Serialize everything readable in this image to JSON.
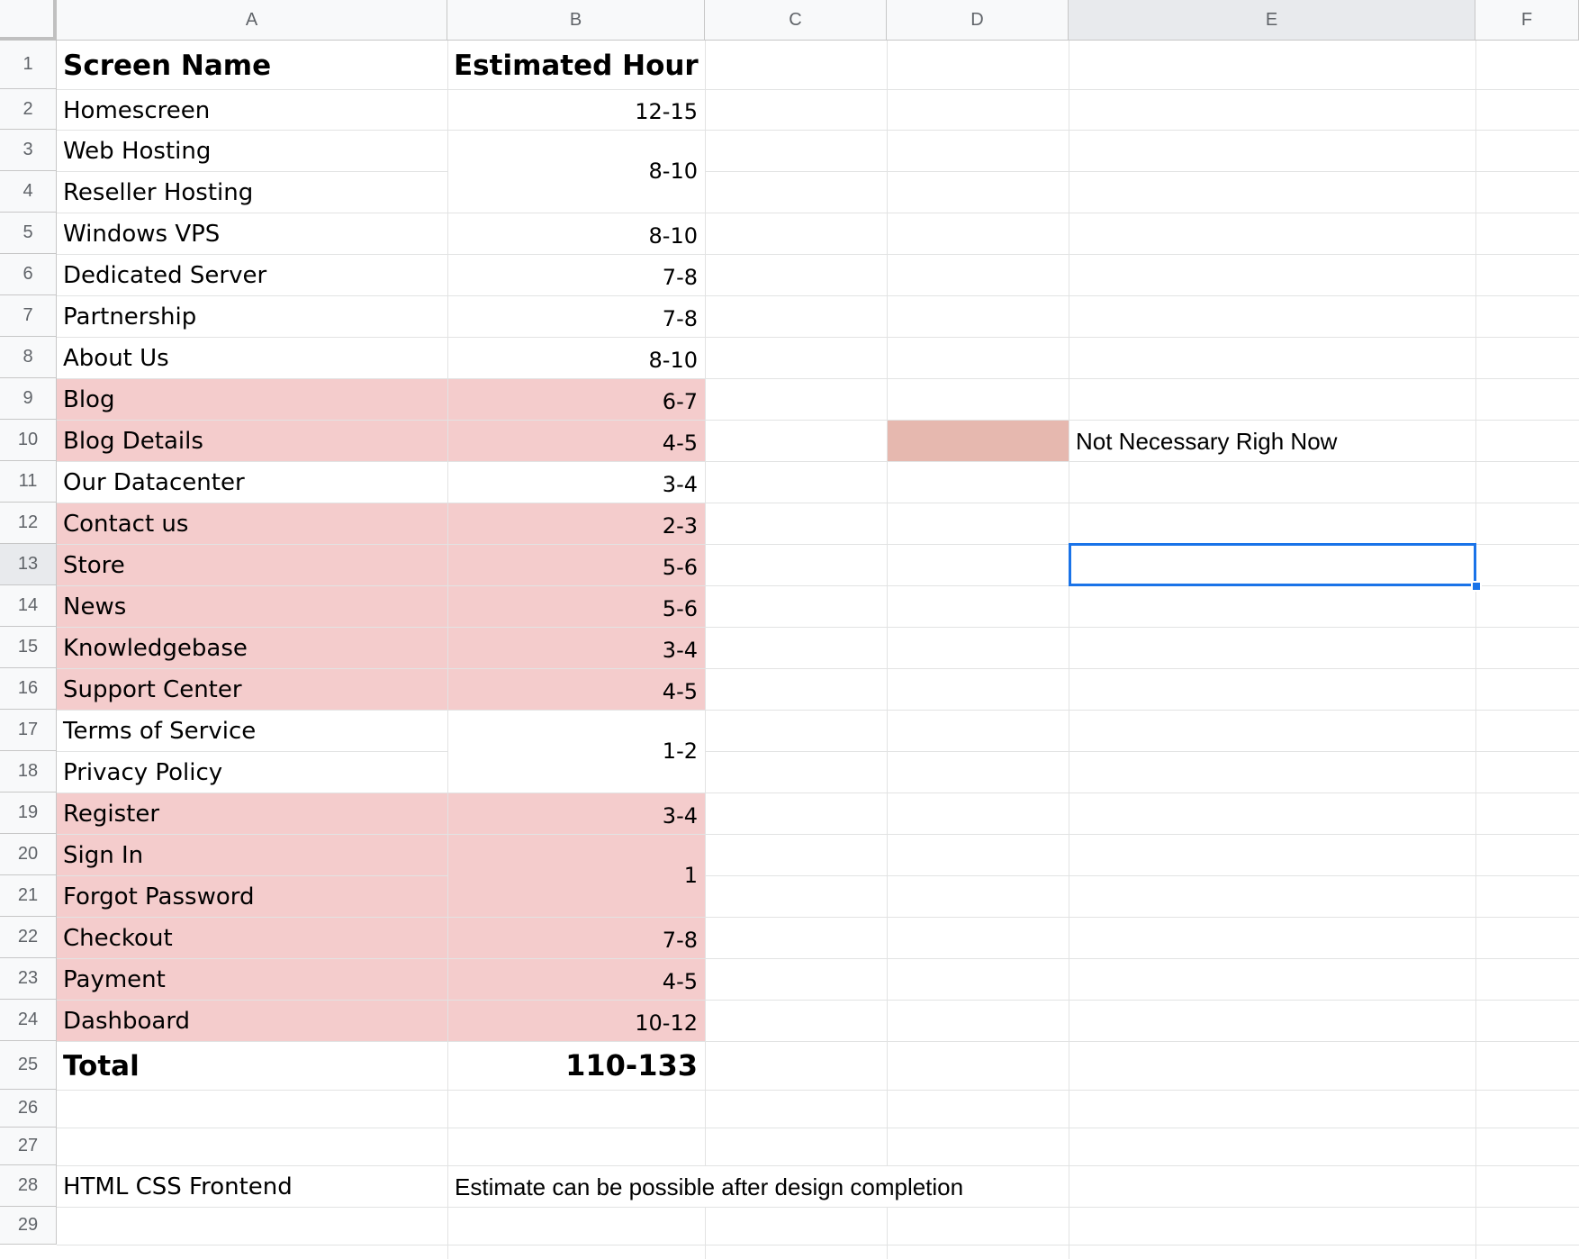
{
  "columns": [
    "A",
    "B",
    "C",
    "D",
    "E",
    "F"
  ],
  "row_numbers": [
    "1",
    "2",
    "3",
    "4",
    "5",
    "6",
    "7",
    "8",
    "9",
    "10",
    "11",
    "12",
    "13",
    "14",
    "15",
    "16",
    "17",
    "18",
    "19",
    "20",
    "21",
    "22",
    "23",
    "24",
    "25",
    "26",
    "27",
    "28",
    "29"
  ],
  "header": {
    "screen_name": "Screen Name",
    "estimated_hour": "Estimated Hour"
  },
  "screens": [
    {
      "name": "Homescreen",
      "not_necessary": false
    },
    {
      "name": "Web Hosting",
      "not_necessary": false
    },
    {
      "name": "Reseller Hosting",
      "not_necessary": false
    },
    {
      "name": "Windows VPS",
      "not_necessary": false
    },
    {
      "name": "Dedicated Server",
      "not_necessary": false
    },
    {
      "name": "Partnership",
      "not_necessary": false
    },
    {
      "name": "About Us",
      "not_necessary": false
    },
    {
      "name": "Blog",
      "not_necessary": true
    },
    {
      "name": "Blog Details",
      "not_necessary": true
    },
    {
      "name": "Our Datacenter",
      "not_necessary": false
    },
    {
      "name": "Contact us",
      "not_necessary": true
    },
    {
      "name": "Store",
      "not_necessary": true
    },
    {
      "name": "News",
      "not_necessary": true
    },
    {
      "name": "Knowledgebase",
      "not_necessary": true
    },
    {
      "name": "Support Center",
      "not_necessary": true
    },
    {
      "name": "Terms of Service",
      "not_necessary": false
    },
    {
      "name": "Privacy Policy",
      "not_necessary": false
    },
    {
      "name": "Register",
      "not_necessary": true
    },
    {
      "name": "Sign In",
      "not_necessary": true
    },
    {
      "name": "Forgot Password",
      "not_necessary": true
    },
    {
      "name": "Checkout",
      "not_necessary": true
    },
    {
      "name": "Payment",
      "not_necessary": true
    },
    {
      "name": "Dashboard",
      "not_necessary": true
    }
  ],
  "hours": [
    {
      "value": "12-15",
      "rows": [
        2
      ]
    },
    {
      "value": "8-10",
      "rows": [
        3,
        4
      ]
    },
    {
      "value": "8-10",
      "rows": [
        5
      ]
    },
    {
      "value": "7-8",
      "rows": [
        6
      ]
    },
    {
      "value": "7-8",
      "rows": [
        7
      ]
    },
    {
      "value": "8-10",
      "rows": [
        8
      ]
    },
    {
      "value": "6-7",
      "rows": [
        9
      ]
    },
    {
      "value": "4-5",
      "rows": [
        10
      ]
    },
    {
      "value": "3-4",
      "rows": [
        11
      ]
    },
    {
      "value": "2-3",
      "rows": [
        12
      ]
    },
    {
      "value": "5-6",
      "rows": [
        13
      ]
    },
    {
      "value": "5-6",
      "rows": [
        14
      ]
    },
    {
      "value": "3-4",
      "rows": [
        15
      ]
    },
    {
      "value": "4-5",
      "rows": [
        16
      ]
    },
    {
      "value": "1-2",
      "rows": [
        17,
        18
      ]
    },
    {
      "value": "3-4",
      "rows": [
        19
      ]
    },
    {
      "value": "1",
      "rows": [
        20,
        21
      ]
    },
    {
      "value": "7-8",
      "rows": [
        22
      ]
    },
    {
      "value": "4-5",
      "rows": [
        23
      ]
    },
    {
      "value": "10-12",
      "rows": [
        24
      ]
    }
  ],
  "total": {
    "label": "Total",
    "value": "110-133"
  },
  "frontend": {
    "label": "HTML CSS Frontend",
    "note": "Estimate can be possible after design completion"
  },
  "legend": {
    "text": "Not Necessary  Righ Now",
    "swatch_color": "#e6b8af"
  },
  "colors": {
    "highlight": "#f4cccc",
    "selection": "#1a73e8"
  },
  "active_cell": "E13"
}
